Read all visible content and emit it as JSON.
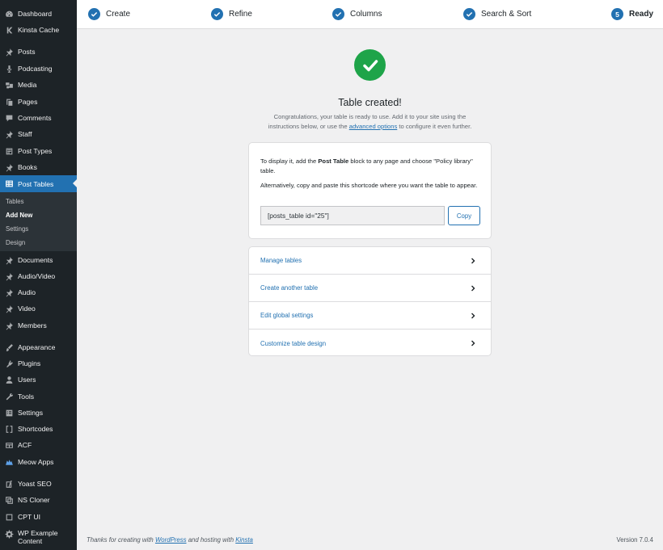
{
  "sidebar": {
    "items": [
      {
        "label": "Dashboard",
        "icon": "dashboard-icon"
      },
      {
        "label": "Kinsta Cache",
        "icon": "kinsta-icon"
      },
      {
        "label": "Posts",
        "icon": "pin-icon"
      },
      {
        "label": "Podcasting",
        "icon": "microphone-icon"
      },
      {
        "label": "Media",
        "icon": "media-icon"
      },
      {
        "label": "Pages",
        "icon": "pages-icon"
      },
      {
        "label": "Comments",
        "icon": "comment-icon"
      },
      {
        "label": "Staff",
        "icon": "pin-icon"
      },
      {
        "label": "Post Types",
        "icon": "post-types-icon"
      },
      {
        "label": "Books",
        "icon": "pin-icon"
      },
      {
        "label": "Post Tables",
        "icon": "table-icon"
      },
      {
        "label": "Documents",
        "icon": "pin-icon"
      },
      {
        "label": "Audio/Video",
        "icon": "pin-icon"
      },
      {
        "label": "Audio",
        "icon": "pin-icon"
      },
      {
        "label": "Video",
        "icon": "pin-icon"
      },
      {
        "label": "Members",
        "icon": "pin-icon"
      },
      {
        "label": "Appearance",
        "icon": "brush-icon"
      },
      {
        "label": "Plugins",
        "icon": "plugin-icon"
      },
      {
        "label": "Users",
        "icon": "user-icon"
      },
      {
        "label": "Tools",
        "icon": "wrench-icon"
      },
      {
        "label": "Settings",
        "icon": "settings-icon"
      },
      {
        "label": "Shortcodes",
        "icon": "brackets-icon"
      },
      {
        "label": "ACF",
        "icon": "acf-icon"
      },
      {
        "label": "Meow Apps",
        "icon": "meow-icon"
      },
      {
        "label": "Yoast SEO",
        "icon": "yoast-icon"
      },
      {
        "label": "NS Cloner",
        "icon": "cloner-icon"
      },
      {
        "label": "CPT UI",
        "icon": "cpt-icon"
      },
      {
        "label": "WP Example Content",
        "icon": "gear-icon"
      }
    ],
    "submenu": [
      "Tables",
      "Add New",
      "Settings",
      "Design"
    ]
  },
  "steps": [
    {
      "label": "Create"
    },
    {
      "label": "Refine"
    },
    {
      "label": "Columns"
    },
    {
      "label": "Search & Sort"
    },
    {
      "label": "Ready",
      "number": "5"
    }
  ],
  "main": {
    "title": "Table created!",
    "desc_line1": "Congratulations, your table is ready to use. Add it to your site using the",
    "desc_line2_a": "instructions below, or use the",
    "desc_link": "advanced options",
    "desc_line2_b": "to configure it even further.",
    "instructions_a": "To display it, add the",
    "instructions_bold": "Post Table",
    "instructions_b": "block to any page and choose \"Policy library\" table.",
    "alt_instructions": "Alternatively, copy and paste this shortcode where you want the table to appear.",
    "shortcode": "[posts_table id=\"25\"]",
    "copy_label": "Copy",
    "links": [
      "Manage tables",
      "Create another table",
      "Edit global settings",
      "Customize table design"
    ]
  },
  "footer": {
    "text_a": "Thanks for creating with",
    "link_wp": "WordPress",
    "text_b": "and hosting with",
    "link_kinsta": "Kinsta",
    "version": "Version 7.0.4"
  },
  "colors": {
    "accent": "#2271b1",
    "success": "#1ea449",
    "sidebar_bg": "#1d2327"
  }
}
